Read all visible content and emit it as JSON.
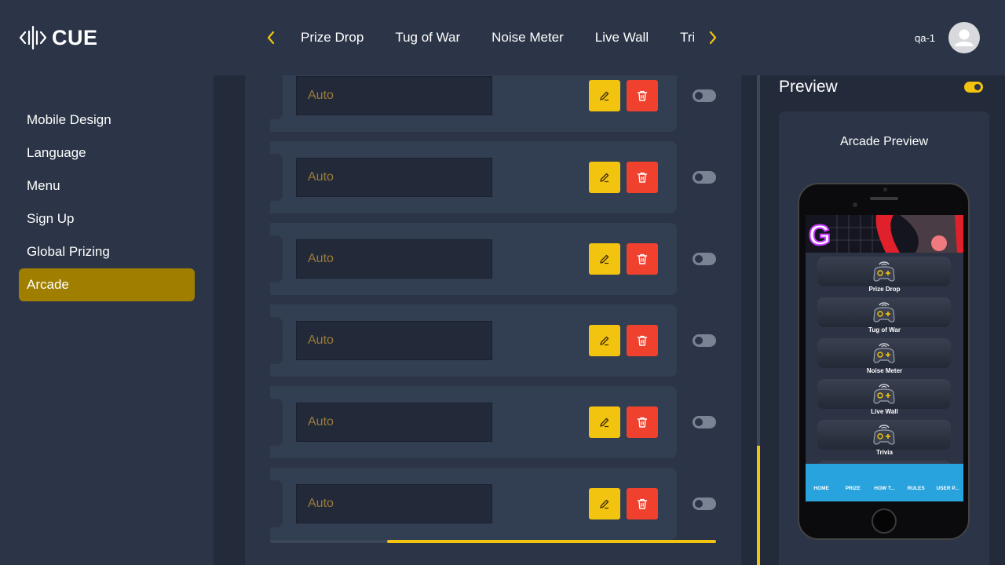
{
  "header": {
    "logo_text": "CUE",
    "tabs": [
      "Prize Drop",
      "Tug of War",
      "Noise Meter",
      "Live Wall",
      "Trivia"
    ],
    "user_name": "qa-1",
    "prev_icon": "chevron-left-icon",
    "next_icon": "chevron-right-icon"
  },
  "sidebar": {
    "items": [
      {
        "label": "Mobile Design",
        "active": false
      },
      {
        "label": "Language",
        "active": false
      },
      {
        "label": "Menu",
        "active": false
      },
      {
        "label": "Sign Up",
        "active": false
      },
      {
        "label": "Global Prizing",
        "active": false
      },
      {
        "label": "Arcade",
        "active": true
      }
    ]
  },
  "rows": [
    {
      "placeholder": "Auto",
      "enabled": false
    },
    {
      "placeholder": "Auto",
      "enabled": false
    },
    {
      "placeholder": "Auto",
      "enabled": false
    },
    {
      "placeholder": "Auto",
      "enabled": false
    },
    {
      "placeholder": "Auto",
      "enabled": false
    },
    {
      "placeholder": "Auto",
      "enabled": false
    }
  ],
  "preview": {
    "title": "Preview",
    "enabled": true,
    "card_title": "Arcade Preview",
    "games": [
      "Prize Drop",
      "Tug of War",
      "Noise Meter",
      "Live Wall",
      "Trivia"
    ],
    "tabbar": [
      "HOME",
      "PRIZE",
      "HOW T...",
      "RULES",
      "USER P..."
    ]
  },
  "colors": {
    "accent": "#f2c40f",
    "danger": "#f0412f",
    "active_nav": "#a07e00",
    "tabbar": "#29a3dd"
  }
}
